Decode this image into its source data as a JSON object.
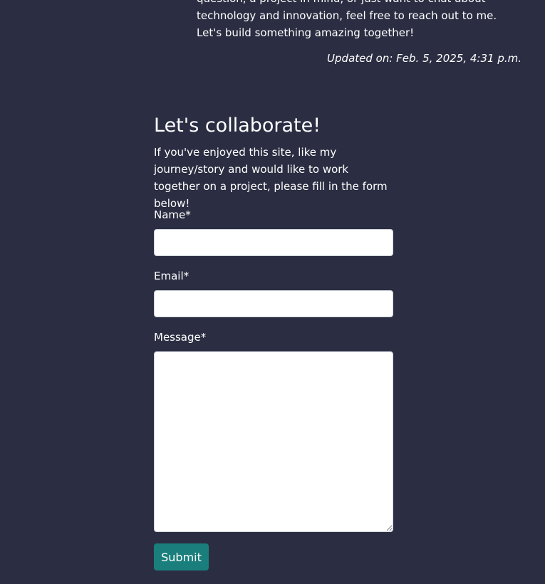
{
  "about": {
    "text": "question, a project in mind, or just want to chat about technology and innovation, feel free to reach out to me. Let's build something amazing together!",
    "updated": "Updated on: Feb. 5, 2025, 4:31 p.m."
  },
  "collaborate": {
    "title": "Let's collaborate!",
    "intro": "If you've enjoyed this site, like my journey/story and would like to work together on a project, please fill in the form below!"
  },
  "form": {
    "name_label": "Name*",
    "name_value": "",
    "email_label": "Email*",
    "email_value": "",
    "message_label": "Message*",
    "message_value": "",
    "submit_label": "Submit"
  },
  "colors": {
    "background": "#2b2e42",
    "text": "#ffffff",
    "submit_button": "#1a7f7c",
    "input_background": "#ffffff"
  }
}
